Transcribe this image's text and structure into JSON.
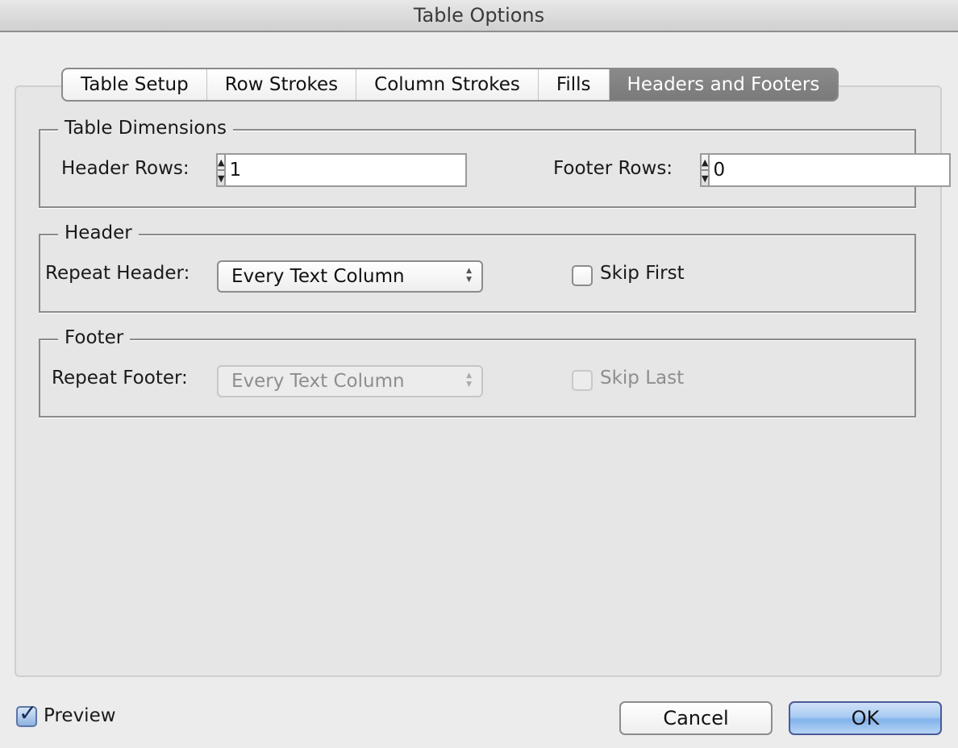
{
  "window": {
    "title": "Table Options"
  },
  "tabs": [
    {
      "label": "Table Setup",
      "active": false
    },
    {
      "label": "Row Strokes",
      "active": false
    },
    {
      "label": "Column Strokes",
      "active": false
    },
    {
      "label": "Fills",
      "active": false
    },
    {
      "label": "Headers and Footers",
      "active": true
    }
  ],
  "table_dimensions": {
    "legend": "Table Dimensions",
    "header_rows_label": "Header Rows:",
    "header_rows_value": "1",
    "footer_rows_label": "Footer Rows:",
    "footer_rows_value": "0"
  },
  "header": {
    "legend": "Header",
    "repeat_label": "Repeat Header:",
    "repeat_value": "Every Text Column",
    "skip_label": "Skip First",
    "skip_checked": false
  },
  "footer": {
    "legend": "Footer",
    "repeat_label": "Repeat Footer:",
    "repeat_value": "Every Text Column",
    "skip_label": "Skip Last",
    "skip_checked": false,
    "disabled": true
  },
  "bottom": {
    "preview_label": "Preview",
    "preview_checked": true,
    "cancel_label": "Cancel",
    "ok_label": "OK"
  },
  "icons": {
    "stepper_up": "▲",
    "stepper_down": "▼",
    "select_arrows_up": "▲",
    "select_arrows_down": "▼",
    "check": "✓"
  }
}
